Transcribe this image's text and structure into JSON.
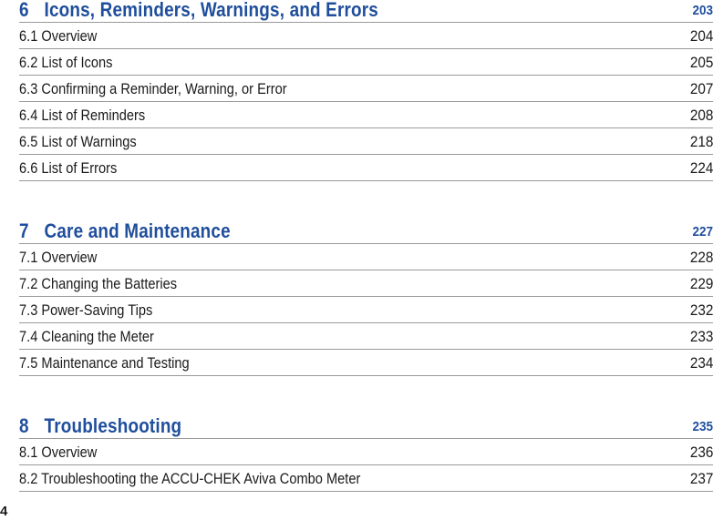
{
  "sections": [
    {
      "number": "6",
      "title": "Icons, Reminders, Warnings, and Errors",
      "page": "203",
      "entries": [
        {
          "label": "6.1 Overview",
          "page": "204"
        },
        {
          "label": "6.2 List of Icons",
          "page": "205"
        },
        {
          "label": "6.3 Confirming a Reminder, Warning, or Error",
          "page": "207"
        },
        {
          "label": "6.4 List of Reminders",
          "page": "208"
        },
        {
          "label": "6.5 List of Warnings",
          "page": "218"
        },
        {
          "label": "6.6 List of Errors",
          "page": "224"
        }
      ]
    },
    {
      "number": "7",
      "title": "Care and Maintenance",
      "page": "227",
      "entries": [
        {
          "label": "7.1 Overview",
          "page": "228"
        },
        {
          "label": "7.2 Changing the Batteries",
          "page": "229"
        },
        {
          "label": "7.3 Power-Saving Tips",
          "page": "232"
        },
        {
          "label": "7.4 Cleaning the Meter",
          "page": "233"
        },
        {
          "label": "7.5 Maintenance and Testing",
          "page": "234"
        }
      ]
    },
    {
      "number": "8",
      "title": "Troubleshooting",
      "page": "235",
      "entries": [
        {
          "label": "8.1 Overview",
          "page": "236"
        },
        {
          "label": "8.2 Troubleshooting the ACCU-CHEK Aviva Combo Meter",
          "page": "237"
        }
      ]
    }
  ],
  "folio": "4",
  "colors": {
    "heading": "#1f4e9c",
    "text": "#1a1a1a",
    "rule": "#9a9a9a"
  }
}
